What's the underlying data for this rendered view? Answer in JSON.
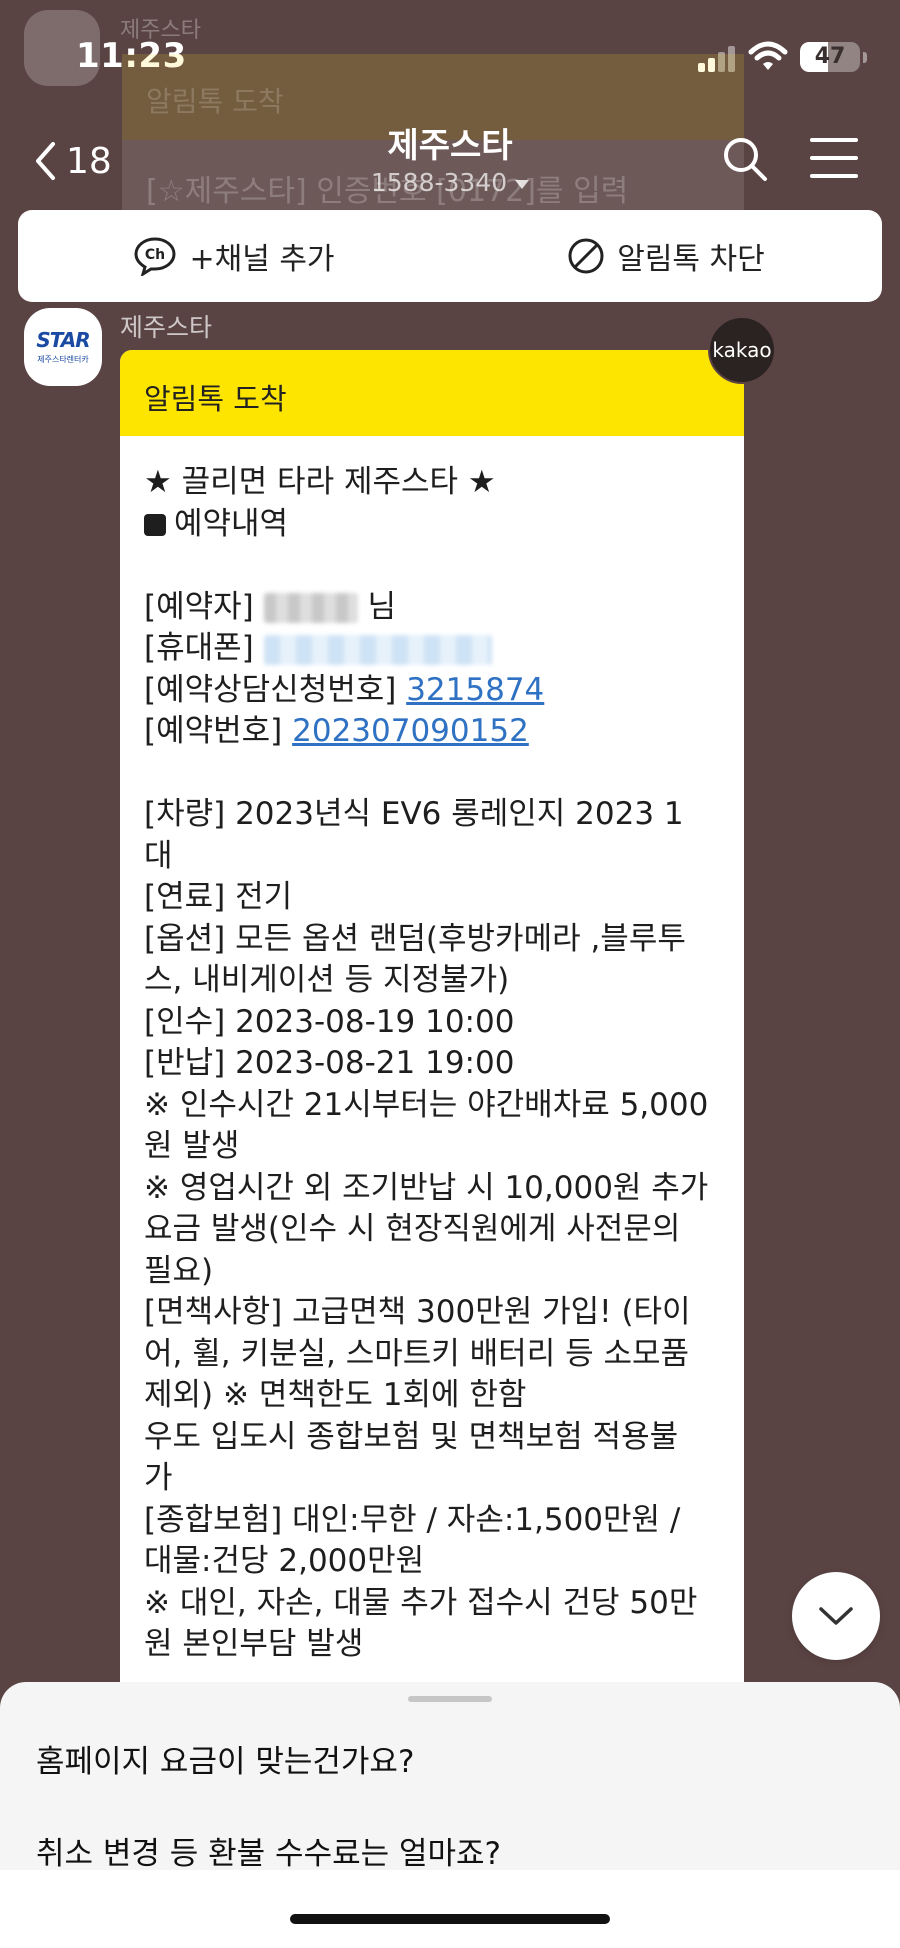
{
  "status_bar": {
    "time": "11:23",
    "battery": "47",
    "battery_level_percent": 47,
    "icons": [
      "signal-icon",
      "wifi-icon",
      "battery-icon"
    ]
  },
  "ghost_notification": {
    "sender": "제주스타",
    "title": "알림톡 도착",
    "preview": "[☆제주스타] 인증번호 [0172]를 입력"
  },
  "header": {
    "back_count": "18",
    "title": "제주스타",
    "phone": "1588-3340",
    "icons": [
      "back-chevron-icon",
      "search-icon",
      "menu-icon"
    ]
  },
  "channel_bar": {
    "add_channel": "+채널 추가",
    "block": "알림톡 차단",
    "icons": [
      "ch-icon",
      "block-icon"
    ]
  },
  "message": {
    "sender_name": "제주스타",
    "avatar_logo": "STAR",
    "avatar_sub": "제주스타렌터카",
    "badge": "kakao",
    "head": "알림톡 도착",
    "lines": {
      "l01": "★ 끌리면 타라 제주스타 ★",
      "l02": "예약내역",
      "l03_label": "[예약자]",
      "l03_suffix": "님",
      "l04_label": "[휴대폰]",
      "l05_label": "[예약상담신청번호] ",
      "l05_link": "3215874",
      "l06_label": "[예약번호] ",
      "l06_link": "202307090152",
      "l07": "[차량] 2023년식 EV6 롱레인지 2023 1",
      "l08": "대",
      "l09": "[연료] 전기",
      "l10": "[옵션] 모든 옵션 랜덤(후방카메라 ,블루투",
      "l11": "스, 내비게이션 등 지정불가)",
      "l12": "[인수] 2023-08-19 10:00",
      "l13": "[반납] 2023-08-21 19:00",
      "l14": "※ 인수시간 21시부터는 야간배차료 5,000",
      "l15": "원 발생",
      "l16": "※ 영업시간 외 조기반납 시 10,000원 추가",
      "l17": "요금 발생(인수 시 현장직원에게 사전문의",
      "l18": "필요)",
      "l19": "[면책사항] 고급면책 300만원 가입! (타이",
      "l20": "어, 휠, 키분실, 스마트키 배터리 등 소모품",
      "l21": "제외) ※ 면책한도 1회에 한함",
      "l22": "우도 입도시 종합보험 및 면책보험 적용불",
      "l23": "가",
      "l24": "[종합보험] 대인:무한 / 자손:1,500만원 /",
      "l25": "대물:건당 2,000만원",
      "l26": "※ 대인, 자손, 대물 추가 접수시 건당 50만",
      "l27": "원 본인부담 발생"
    }
  },
  "scroll_down": {
    "icon": "chevron-down-icon"
  },
  "bottom_sheet": {
    "suggestion_1": "홈페이지 요금이 맞는건가요?",
    "suggestion_2": "취소 변경 등 환불 수수료는 얼마죠?"
  },
  "colors": {
    "chat_background": "#5a4343",
    "alimtalk_header": "#fee500",
    "link": "#2f71c2",
    "brand_blue": "#1b4aa3"
  }
}
